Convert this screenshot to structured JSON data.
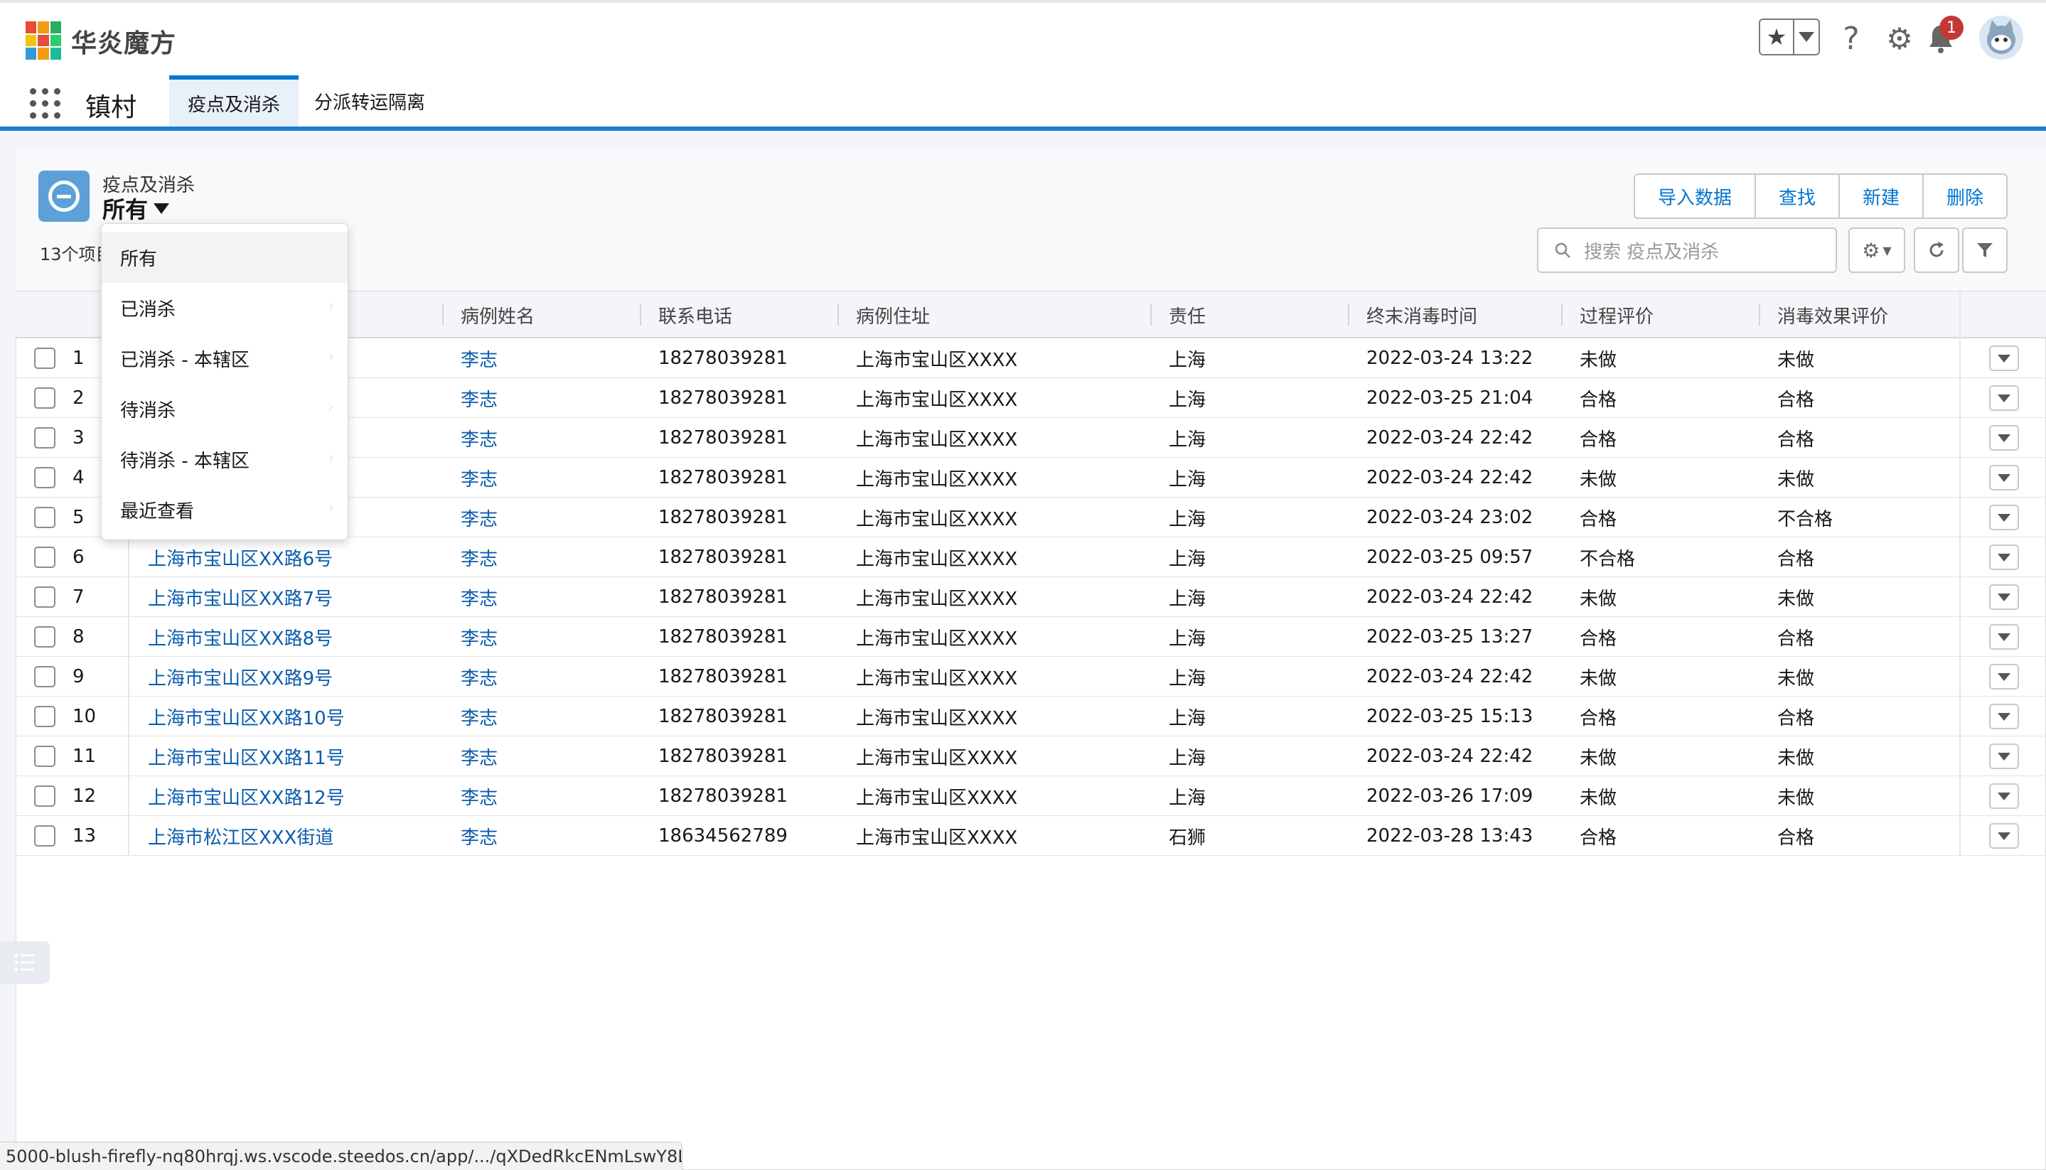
{
  "brand": {
    "name": "华炎魔方"
  },
  "app": {
    "name": "镇村"
  },
  "tabs": [
    {
      "label": "疫点及消杀"
    },
    {
      "label": "分派转运隔离"
    }
  ],
  "notifications": {
    "count": "1"
  },
  "object": {
    "label": "疫点及消杀",
    "current_view": "所有",
    "item_count": "13个项目"
  },
  "actions": {
    "import": "导入数据",
    "find": "查找",
    "new": "新建",
    "delete": "删除"
  },
  "search": {
    "placeholder": "搜索 疫点及消杀"
  },
  "columns": [
    "病例姓名",
    "联系电话",
    "病例住址",
    "责任",
    "终末消毒时间",
    "过程评价",
    "消毒效果评价"
  ],
  "views": [
    {
      "label": "所有"
    },
    {
      "label": "已消杀"
    },
    {
      "label": "已消杀 - 本辖区"
    },
    {
      "label": "待消杀"
    },
    {
      "label": "待消杀 - 本辖区"
    },
    {
      "label": "最近查看"
    }
  ],
  "rows": [
    {
      "num": "1",
      "name": "",
      "patient": "李志",
      "phone": "18278039281",
      "address": "上海市宝山区XXXX",
      "resp": "上海",
      "time": "2022-03-24 13:22",
      "process": "未做",
      "effect": "未做"
    },
    {
      "num": "2",
      "name": "",
      "patient": "李志",
      "phone": "18278039281",
      "address": "上海市宝山区XXXX",
      "resp": "上海",
      "time": "2022-03-25 21:04",
      "process": "合格",
      "effect": "合格"
    },
    {
      "num": "3",
      "name": "",
      "patient": "李志",
      "phone": "18278039281",
      "address": "上海市宝山区XXXX",
      "resp": "上海",
      "time": "2022-03-24 22:42",
      "process": "合格",
      "effect": "合格"
    },
    {
      "num": "4",
      "name": "",
      "patient": "李志",
      "phone": "18278039281",
      "address": "上海市宝山区XXXX",
      "resp": "上海",
      "time": "2022-03-24 22:42",
      "process": "未做",
      "effect": "未做"
    },
    {
      "num": "5",
      "name": "",
      "patient": "李志",
      "phone": "18278039281",
      "address": "上海市宝山区XXXX",
      "resp": "上海",
      "time": "2022-03-24 23:02",
      "process": "合格",
      "effect": "不合格"
    },
    {
      "num": "6",
      "name": "上海市宝山区XX路6号",
      "patient": "李志",
      "phone": "18278039281",
      "address": "上海市宝山区XXXX",
      "resp": "上海",
      "time": "2022-03-25 09:57",
      "process": "不合格",
      "effect": "合格"
    },
    {
      "num": "7",
      "name": "上海市宝山区XX路7号",
      "patient": "李志",
      "phone": "18278039281",
      "address": "上海市宝山区XXXX",
      "resp": "上海",
      "time": "2022-03-24 22:42",
      "process": "未做",
      "effect": "未做"
    },
    {
      "num": "8",
      "name": "上海市宝山区XX路8号",
      "patient": "李志",
      "phone": "18278039281",
      "address": "上海市宝山区XXXX",
      "resp": "上海",
      "time": "2022-03-25 13:27",
      "process": "合格",
      "effect": "合格"
    },
    {
      "num": "9",
      "name": "上海市宝山区XX路9号",
      "patient": "李志",
      "phone": "18278039281",
      "address": "上海市宝山区XXXX",
      "resp": "上海",
      "time": "2022-03-24 22:42",
      "process": "未做",
      "effect": "未做"
    },
    {
      "num": "10",
      "name": "上海市宝山区XX路10号",
      "patient": "李志",
      "phone": "18278039281",
      "address": "上海市宝山区XXXX",
      "resp": "上海",
      "time": "2022-03-25 15:13",
      "process": "合格",
      "effect": "合格"
    },
    {
      "num": "11",
      "name": "上海市宝山区XX路11号",
      "patient": "李志",
      "phone": "18278039281",
      "address": "上海市宝山区XXXX",
      "resp": "上海",
      "time": "2022-03-24 22:42",
      "process": "未做",
      "effect": "未做"
    },
    {
      "num": "12",
      "name": "上海市宝山区XX路12号",
      "patient": "李志",
      "phone": "18278039281",
      "address": "上海市宝山区XXXX",
      "resp": "上海",
      "time": "2022-03-26 17:09",
      "process": "未做",
      "effect": "未做"
    },
    {
      "num": "13",
      "name": "上海市松江区XXX街道",
      "patient": "李志",
      "phone": "18634562789",
      "address": "上海市宝山区XXXX",
      "resp": "石狮",
      "time": "2022-03-28 13:43",
      "process": "合格",
      "effect": "合格"
    }
  ],
  "status_bar": {
    "url": "5000-blush-firefly-nq80hrqj.ws.vscode.steedos.cn/app/.../qXDedRkcENmLswY8L"
  },
  "colors": {
    "accent": "#0176d3",
    "link": "#0b5cad",
    "nav_line": "#1b7bd4",
    "badge": "#c23934"
  }
}
